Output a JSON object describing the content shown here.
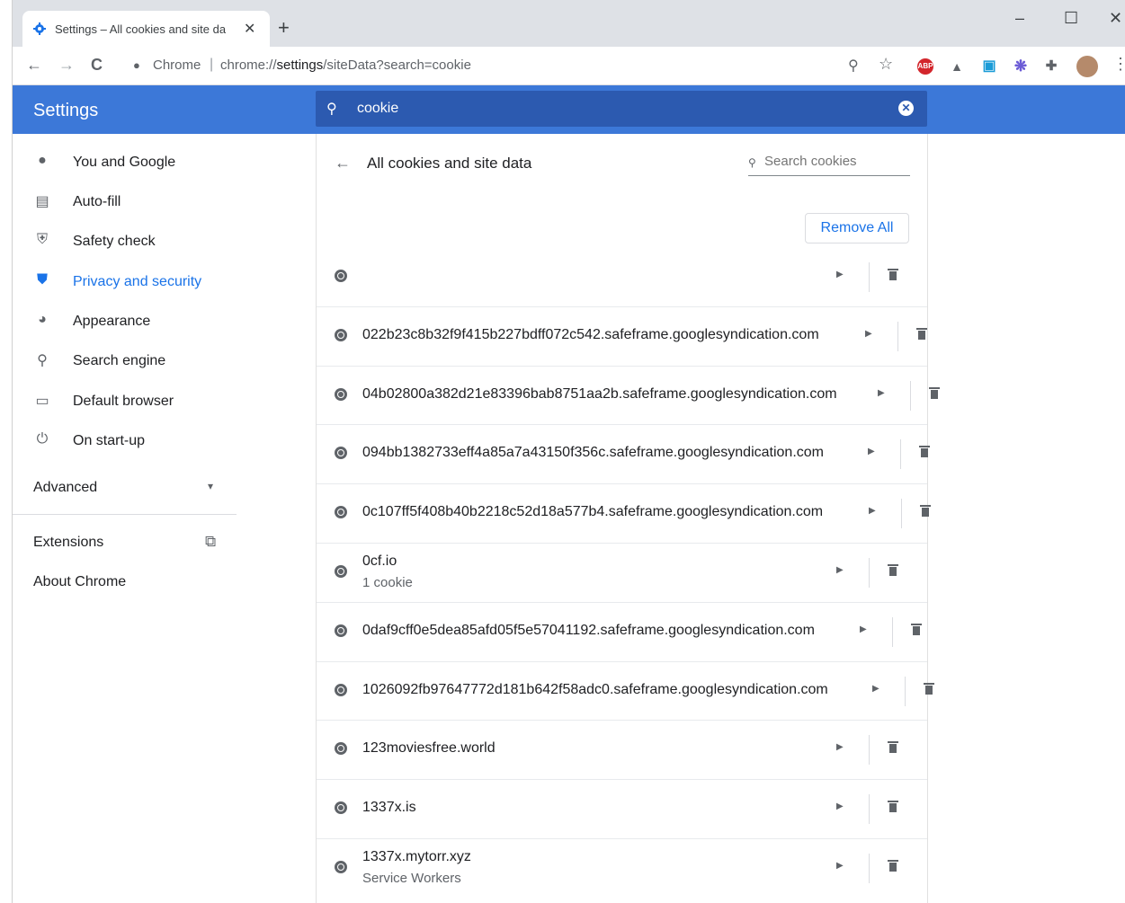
{
  "tab": {
    "title": "Settings – All cookies and site da",
    "close": "✕",
    "new": "+"
  },
  "window": {
    "minimize": "–",
    "maximize": "☐",
    "close": "✕"
  },
  "toolbar": {
    "back": "←",
    "forward": "→",
    "reload": "C",
    "omni_label": "Chrome",
    "url_prefix": "chrome://",
    "url_host": "settings",
    "url_rest": "/siteData?search=cookie",
    "zoom_icon": "⚲",
    "star_icon": "☆",
    "menu_icon": "⋮",
    "extensions": [
      {
        "name": "adblock-plus-icon",
        "text": "ABP",
        "color": "#d3262c"
      },
      {
        "name": "drive-icon",
        "text": "▲",
        "color": "#5f6368"
      },
      {
        "name": "screen-capture-icon",
        "text": "▣",
        "color": "#1a9bd7"
      },
      {
        "name": "flower-icon",
        "text": "❋",
        "color": "#6b5bd6"
      },
      {
        "name": "puzzle-icon",
        "text": "✚",
        "color": "#5f6368"
      }
    ]
  },
  "header": {
    "title": "Settings",
    "search_value": "cookie"
  },
  "sidebar": {
    "items": [
      {
        "label": "You and Google",
        "icon": "person-icon",
        "glyph": "●"
      },
      {
        "label": "Auto-fill",
        "icon": "clipboard-icon",
        "glyph": "▤"
      },
      {
        "label": "Safety check",
        "icon": "shield-icon",
        "glyph": "⛨"
      },
      {
        "label": "Privacy and security",
        "icon": "privacy-shield-icon",
        "glyph": "⛊"
      },
      {
        "label": "Appearance",
        "icon": "palette-icon",
        "glyph": "◕"
      },
      {
        "label": "Search engine",
        "icon": "search-icon",
        "glyph": "⚲"
      },
      {
        "label": "Default browser",
        "icon": "browser-icon",
        "glyph": "▭"
      },
      {
        "label": "On start-up",
        "icon": "power-icon",
        "glyph": "⏻"
      }
    ],
    "advanced": "Advanced",
    "advanced_arrow": "▾",
    "extensions": "Extensions",
    "external_icon": "⧉",
    "about": "About Chrome"
  },
  "main": {
    "title": "All cookies and site data",
    "search_placeholder": "Search cookies",
    "remove_all": "Remove All",
    "rows": [
      {
        "site": "",
        "sub": ""
      },
      {
        "site": "022b23c8b32f9f415b227bdff072c542.safeframe.googlesyndication.com",
        "sub": ""
      },
      {
        "site": "04b02800a382d21e83396bab8751aa2b.safeframe.googlesyndication.com",
        "sub": ""
      },
      {
        "site": "094bb1382733eff4a85a7a43150f356c.safeframe.googlesyndication.com",
        "sub": ""
      },
      {
        "site": "0c107ff5f408b40b2218c52d18a577b4.safeframe.googlesyndication.com",
        "sub": ""
      },
      {
        "site": "0cf.io",
        "sub": "1 cookie"
      },
      {
        "site": "0daf9cff0e5dea85afd05f5e57041192.safeframe.googlesyndication.com",
        "sub": ""
      },
      {
        "site": "1026092fb97647772d181b642f58adc0.safeframe.googlesyndication.com",
        "sub": ""
      },
      {
        "site": "123moviesfree.world",
        "sub": ""
      },
      {
        "site": "1337x.is",
        "sub": ""
      },
      {
        "site": "1337x.mytorr.xyz",
        "sub": "Service Workers"
      }
    ]
  }
}
